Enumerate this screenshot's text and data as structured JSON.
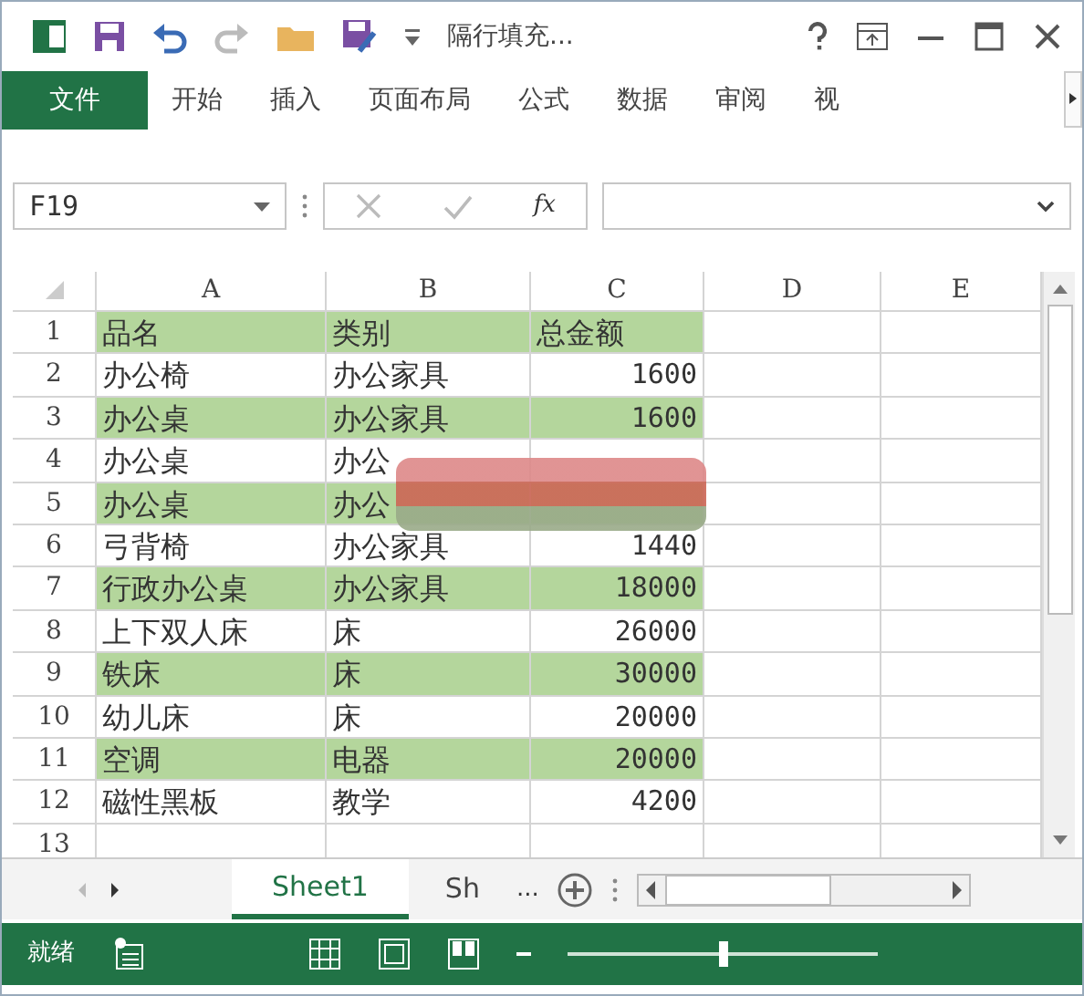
{
  "window": {
    "title": "隔行填充..."
  },
  "ribbon_tabs": [
    {
      "label": "文件",
      "selected": true
    },
    {
      "label": "开始",
      "selected": false
    },
    {
      "label": "插入",
      "selected": false
    },
    {
      "label": "页面布局",
      "selected": false
    },
    {
      "label": "公式",
      "selected": false
    },
    {
      "label": "数据",
      "selected": false
    },
    {
      "label": "审阅",
      "selected": false
    },
    {
      "label": "视",
      "selected": false
    }
  ],
  "formula_bar": {
    "name_box": "F19",
    "fx": "fx"
  },
  "columns": [
    "A",
    "B",
    "C",
    "D",
    "E"
  ],
  "rows": [
    {
      "num": "1",
      "cells": [
        "品名",
        "类别",
        "总金额"
      ],
      "filled": true,
      "kind": "header"
    },
    {
      "num": "2",
      "cells": [
        "办公椅",
        "办公家具",
        "1600"
      ],
      "filled": false
    },
    {
      "num": "3",
      "cells": [
        "办公桌",
        "办公家具",
        "1600"
      ],
      "filled": true
    },
    {
      "num": "4",
      "cells": [
        "办公桌",
        "办公",
        ""
      ],
      "filled": false,
      "redacted": true
    },
    {
      "num": "5",
      "cells": [
        "办公桌",
        "办公",
        ""
      ],
      "filled": true,
      "redacted": true
    },
    {
      "num": "6",
      "cells": [
        "弓背椅",
        "办公家具",
        "1440"
      ],
      "filled": false
    },
    {
      "num": "7",
      "cells": [
        "行政办公桌",
        "办公家具",
        "18000"
      ],
      "filled": true
    },
    {
      "num": "8",
      "cells": [
        "上下双人床",
        "床",
        "26000"
      ],
      "filled": false
    },
    {
      "num": "9",
      "cells": [
        "铁床",
        "床",
        "30000"
      ],
      "filled": true
    },
    {
      "num": "10",
      "cells": [
        "幼儿床",
        "床",
        "20000"
      ],
      "filled": false
    },
    {
      "num": "11",
      "cells": [
        "空调",
        "电器",
        "20000"
      ],
      "filled": true
    },
    {
      "num": "12",
      "cells": [
        "磁性黑板",
        "教学",
        "4200"
      ],
      "filled": false
    },
    {
      "num": "13",
      "cells": [
        "",
        "",
        ""
      ],
      "filled": false
    }
  ],
  "sheet_tabs": [
    {
      "label": "Sheet1",
      "selected": true
    },
    {
      "label": "Sh",
      "selected": false
    }
  ],
  "sheet_more": "...",
  "status_bar": {
    "text": "就绪"
  },
  "zoom_slider": {
    "level": 0.5
  }
}
